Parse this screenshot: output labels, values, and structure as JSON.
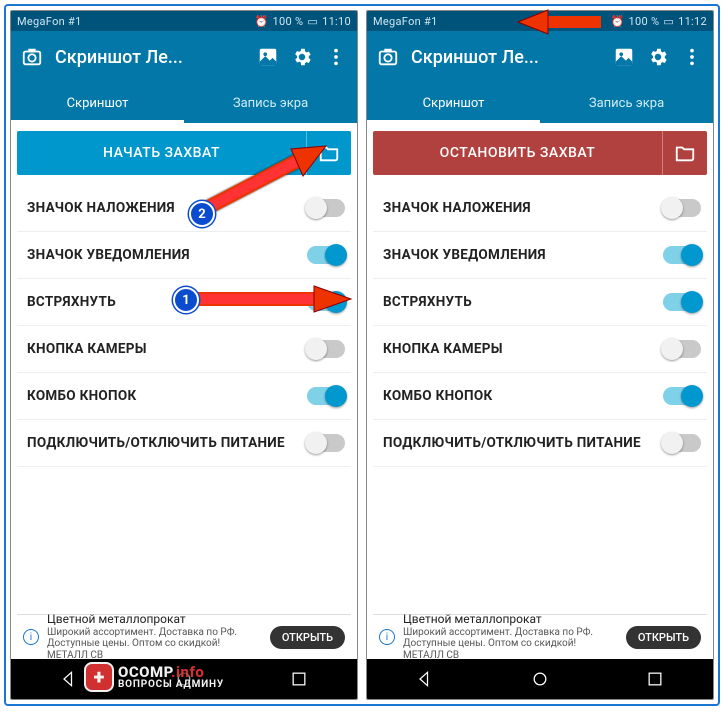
{
  "status": {
    "carrier": "MegaFon #1",
    "battery": "100 %",
    "time_left": "11:10",
    "time_right": "11:12",
    "alarm_glyph": "⏰",
    "signal_glyph": "📶",
    "wifi_glyph": "📡",
    "batt_glyph": "▭"
  },
  "appbar": {
    "title": "Скриншот Ле..."
  },
  "tabs": {
    "screenshot": "Скриншот",
    "record": "Запись экра"
  },
  "buttons": {
    "start": "НАЧАТЬ ЗАХВАТ",
    "stop": "ОСТАНОВИТЬ ЗАХВАТ"
  },
  "rows": [
    {
      "label": "ЗНАЧОК НАЛОЖЕНИЯ",
      "on": false
    },
    {
      "label": "ЗНАЧОК УВЕДОМЛЕНИЯ",
      "on": true
    },
    {
      "label": "ВСТРЯХНУТЬ",
      "on": true
    },
    {
      "label": "КНОПКА КАМЕРЫ",
      "on": false
    },
    {
      "label": "КОМБО КНОПОК",
      "on": true
    },
    {
      "label": "ПОДКЛЮЧИТЬ/ОТКЛЮЧИТЬ ПИТАНИЕ",
      "on": false
    }
  ],
  "ad": {
    "title": "Цветной металлопрокат",
    "text": "Широкий ассортимент. Доставка по РФ. Доступные цены. Оптом со скидкой! МЕТАЛЛ СВ",
    "open": "ОТКРЫТЬ"
  },
  "annot": {
    "b1": "1",
    "b2": "2"
  },
  "watermark": {
    "line1a": "OCOMP",
    "line1b": ".info",
    "line2": "ВОПРОСЫ АДМИНУ"
  }
}
